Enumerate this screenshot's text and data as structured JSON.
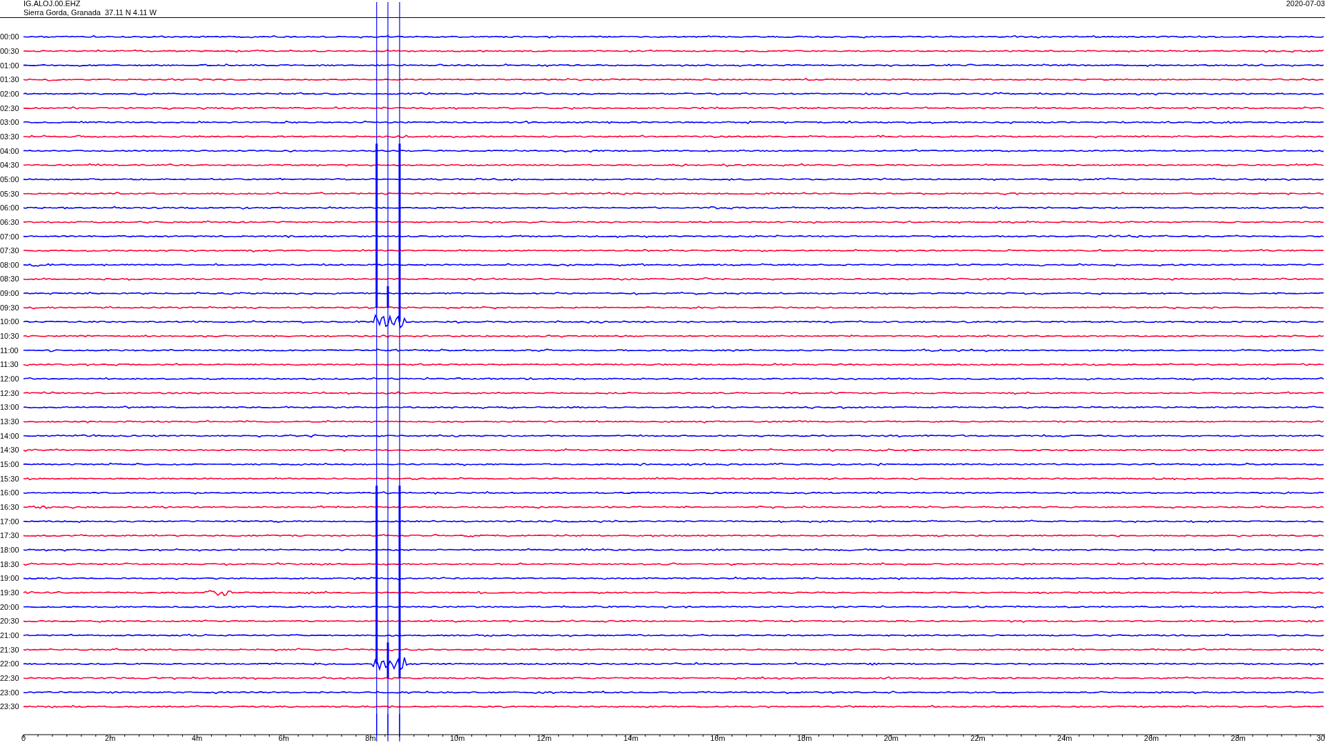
{
  "header": {
    "station": "IG.ALOJ.00.EHZ",
    "location": "Sierra Gorda, Granada  37.11 N 4.11 W",
    "date": "2020-07-03"
  },
  "rows": [
    {
      "label": "00:00",
      "color": "#0000ff"
    },
    {
      "label": "00:30",
      "color": "#ff0033"
    },
    {
      "label": "01:00",
      "color": "#0000ff"
    },
    {
      "label": "01:30",
      "color": "#ff0033"
    },
    {
      "label": "02:00",
      "color": "#0000ff"
    },
    {
      "label": "02:30",
      "color": "#ff0033"
    },
    {
      "label": "03:00",
      "color": "#0000ff"
    },
    {
      "label": "03:30",
      "color": "#ff0033"
    },
    {
      "label": "04:00",
      "color": "#0000ff"
    },
    {
      "label": "04:30",
      "color": "#ff0033"
    },
    {
      "label": "05:00",
      "color": "#0000ff"
    },
    {
      "label": "05:30",
      "color": "#ff0033"
    },
    {
      "label": "06:00",
      "color": "#0000ff"
    },
    {
      "label": "06:30",
      "color": "#ff0033"
    },
    {
      "label": "07:00",
      "color": "#0000ff"
    },
    {
      "label": "07:30",
      "color": "#ff0033"
    },
    {
      "label": "08:00",
      "color": "#0000ff"
    },
    {
      "label": "08:30",
      "color": "#ff0033"
    },
    {
      "label": "09:00",
      "color": "#0000ff"
    },
    {
      "label": "09:30",
      "color": "#ff0033"
    },
    {
      "label": "10:00",
      "color": "#0000ff"
    },
    {
      "label": "10:30",
      "color": "#ff0033"
    },
    {
      "label": "11:00",
      "color": "#0000ff"
    },
    {
      "label": "11:30",
      "color": "#ff0033"
    },
    {
      "label": "12:00",
      "color": "#0000ff"
    },
    {
      "label": "12:30",
      "color": "#ff0033"
    },
    {
      "label": "13:00",
      "color": "#0000ff"
    },
    {
      "label": "13:30",
      "color": "#ff0033"
    },
    {
      "label": "14:00",
      "color": "#0000ff"
    },
    {
      "label": "14:30",
      "color": "#ff0033"
    },
    {
      "label": "15:00",
      "color": "#0000ff"
    },
    {
      "label": "15:30",
      "color": "#ff0033"
    },
    {
      "label": "16:00",
      "color": "#0000ff"
    },
    {
      "label": "16:30",
      "color": "#ff0033"
    },
    {
      "label": "17:00",
      "color": "#0000ff"
    },
    {
      "label": "17:30",
      "color": "#ff0033"
    },
    {
      "label": "18:00",
      "color": "#0000ff"
    },
    {
      "label": "18:30",
      "color": "#ff0033"
    },
    {
      "label": "19:00",
      "color": "#0000ff"
    },
    {
      "label": "19:30",
      "color": "#ff0033"
    },
    {
      "label": "20:00",
      "color": "#0000ff"
    },
    {
      "label": "20:30",
      "color": "#ff0033"
    },
    {
      "label": "21:00",
      "color": "#0000ff"
    },
    {
      "label": "21:30",
      "color": "#ff0033"
    },
    {
      "label": "22:00",
      "color": "#0000ff"
    },
    {
      "label": "22:30",
      "color": "#ff0033"
    },
    {
      "label": "23:00",
      "color": "#0000ff"
    },
    {
      "label": "23:30",
      "color": "#ff0033"
    }
  ],
  "x_axis": {
    "ticks": [
      "0",
      "2m",
      "4m",
      "6m",
      "8m",
      "10m",
      "12m",
      "14m",
      "16m",
      "18m",
      "20m",
      "22m",
      "24m",
      "26m",
      "28m",
      "30"
    ]
  }
}
